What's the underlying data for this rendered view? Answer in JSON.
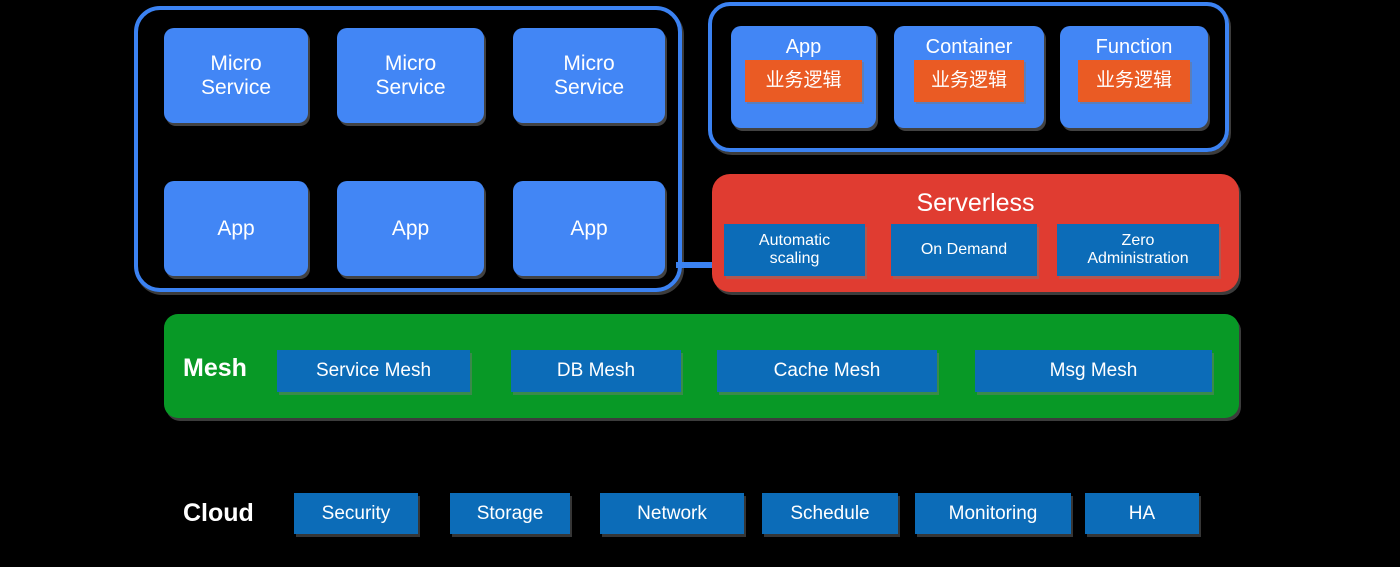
{
  "diagram": {
    "background_color": "#000000",
    "palette": {
      "blue_card": "#4286f5",
      "blue_chip": "#0c6cb8",
      "orange_chip": "#ea5b24",
      "red_band": "#e03c31",
      "green_band": "#089926",
      "outline_blue": "#3b82f2",
      "text": "#ffffff"
    },
    "application_group": {
      "microservices": [
        {
          "line1": "Micro",
          "line2": "Service"
        },
        {
          "line1": "Micro",
          "line2": "Service"
        },
        {
          "line1": "Micro",
          "line2": "Service"
        }
      ],
      "apps": [
        {
          "label": "App"
        },
        {
          "label": "App"
        },
        {
          "label": "App"
        }
      ]
    },
    "runtime_group": {
      "items": [
        {
          "title": "App",
          "payload": "业务逻辑"
        },
        {
          "title": "Container",
          "payload": "业务逻辑"
        },
        {
          "title": "Function",
          "payload": "业务逻辑"
        }
      ]
    },
    "serverless": {
      "title": "Serverless",
      "features": [
        {
          "line1": "Automatic",
          "line2": "scaling"
        },
        {
          "line1": "On Demand",
          "line2": ""
        },
        {
          "line1": "Zero",
          "line2": "Administration"
        }
      ]
    },
    "mesh": {
      "label": "Mesh",
      "items": [
        {
          "label": "Service Mesh"
        },
        {
          "label": "DB Mesh"
        },
        {
          "label": "Cache Mesh"
        },
        {
          "label": "Msg Mesh"
        }
      ]
    },
    "cloud": {
      "label": "Cloud",
      "items": [
        {
          "label": "Security"
        },
        {
          "label": "Storage"
        },
        {
          "label": "Network"
        },
        {
          "label": "Schedule"
        },
        {
          "label": "Monitoring"
        },
        {
          "label": "HA"
        }
      ]
    }
  }
}
